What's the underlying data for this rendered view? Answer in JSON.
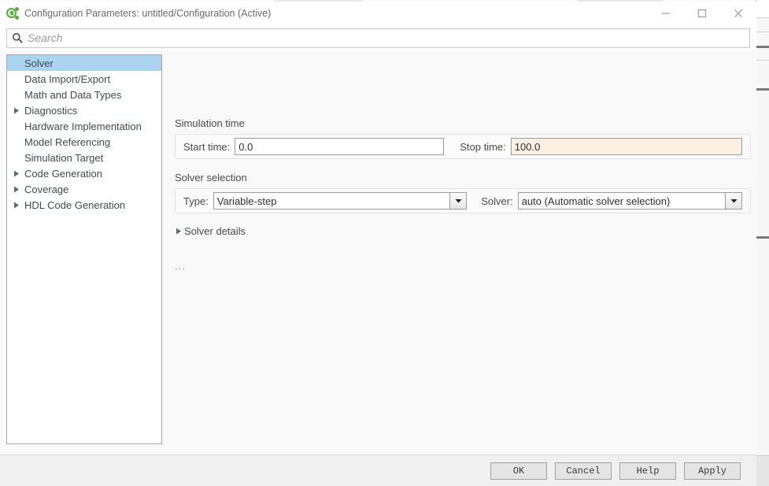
{
  "window": {
    "title": "Configuration Parameters: untitled/Configuration (Active)",
    "app_icon": "simulink-icon",
    "controls": {
      "minimize": "minimize-icon",
      "maximize": "maximize-icon",
      "close": "close-icon"
    }
  },
  "search": {
    "icon": "search-icon",
    "placeholder": "Search",
    "value": ""
  },
  "sidebar": {
    "items": [
      {
        "label": "Solver",
        "expandable": false,
        "selected": true
      },
      {
        "label": "Data Import/Export",
        "expandable": false,
        "selected": false
      },
      {
        "label": "Math and Data Types",
        "expandable": false,
        "selected": false
      },
      {
        "label": "Diagnostics",
        "expandable": true,
        "selected": false
      },
      {
        "label": "Hardware Implementation",
        "expandable": false,
        "selected": false
      },
      {
        "label": "Model Referencing",
        "expandable": false,
        "selected": false
      },
      {
        "label": "Simulation Target",
        "expandable": false,
        "selected": false
      },
      {
        "label": "Code Generation",
        "expandable": true,
        "selected": false
      },
      {
        "label": "Coverage",
        "expandable": true,
        "selected": false
      },
      {
        "label": "HDL Code Generation",
        "expandable": true,
        "selected": false
      }
    ]
  },
  "main": {
    "simulation_time": {
      "group_label": "Simulation time",
      "start_label": "Start time:",
      "start_value": "0.0",
      "stop_label": "Stop time:",
      "stop_value": "100.0"
    },
    "solver_selection": {
      "group_label": "Solver selection",
      "type_label": "Type:",
      "type_value": "Variable-step",
      "solver_label": "Solver:",
      "solver_value": "auto (Automatic solver selection)"
    },
    "solver_details": {
      "label": "Solver details",
      "expanded": false
    },
    "overflow_indicator": "..."
  },
  "footer": {
    "ok": "OK",
    "cancel": "Cancel",
    "help": "Help",
    "apply": "Apply"
  },
  "colors": {
    "selection": "#aad4f0",
    "modified_field": "#fdf0e3",
    "accent_green": "#56b03a",
    "footer_bg": "#f0f0f0"
  }
}
